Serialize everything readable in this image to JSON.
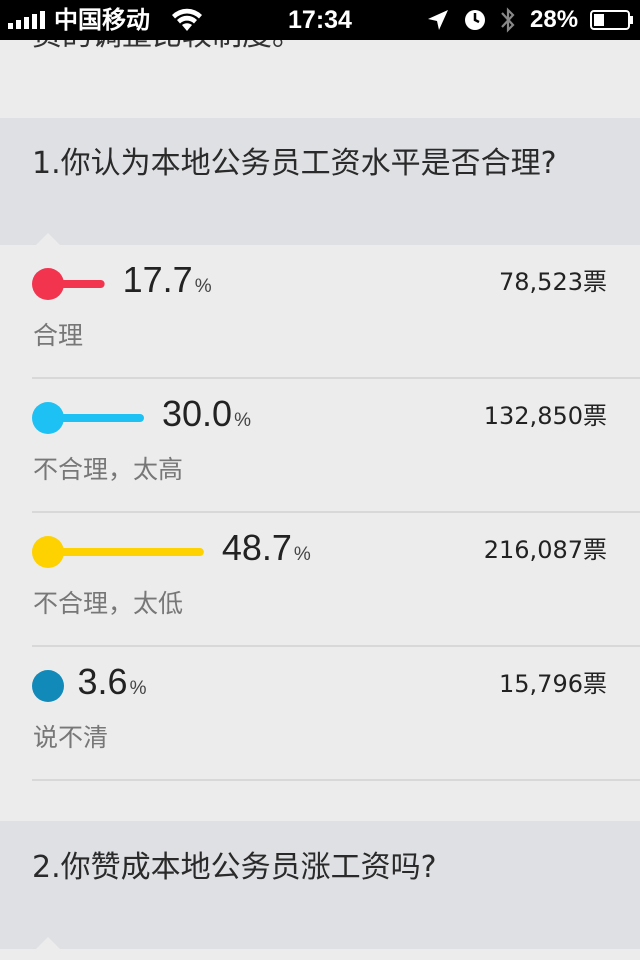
{
  "status_bar": {
    "carrier": "中国移动",
    "time": "17:34",
    "battery": "28%",
    "icons": [
      "signal-icon",
      "wifi-icon",
      "location-icon",
      "clock-icon",
      "bluetooth-icon",
      "battery-icon"
    ]
  },
  "previous_text": "资的调整比较制度。",
  "questions": [
    {
      "text": "1.你认为本地公务员工资水平是否合理?",
      "options": [
        {
          "percent": "17.7",
          "unit": "%",
          "votes": "78,523票",
          "label": "合理",
          "color": "#f2344f",
          "fraction": 0.177
        },
        {
          "percent": "30.0",
          "unit": "%",
          "votes": "132,850票",
          "label": "不合理，太高",
          "color": "#1ec1f3",
          "fraction": 0.3
        },
        {
          "percent": "48.7",
          "unit": "%",
          "votes": "216,087票",
          "label": "不合理，太低",
          "color": "#fed101",
          "fraction": 0.487
        },
        {
          "percent": "3.6",
          "unit": "%",
          "votes": "15,796票",
          "label": "说不清",
          "color": "#118ab9",
          "fraction": 0.036
        }
      ]
    },
    {
      "text": "2.你赞成本地公务员涨工资吗?",
      "options": []
    }
  ]
}
